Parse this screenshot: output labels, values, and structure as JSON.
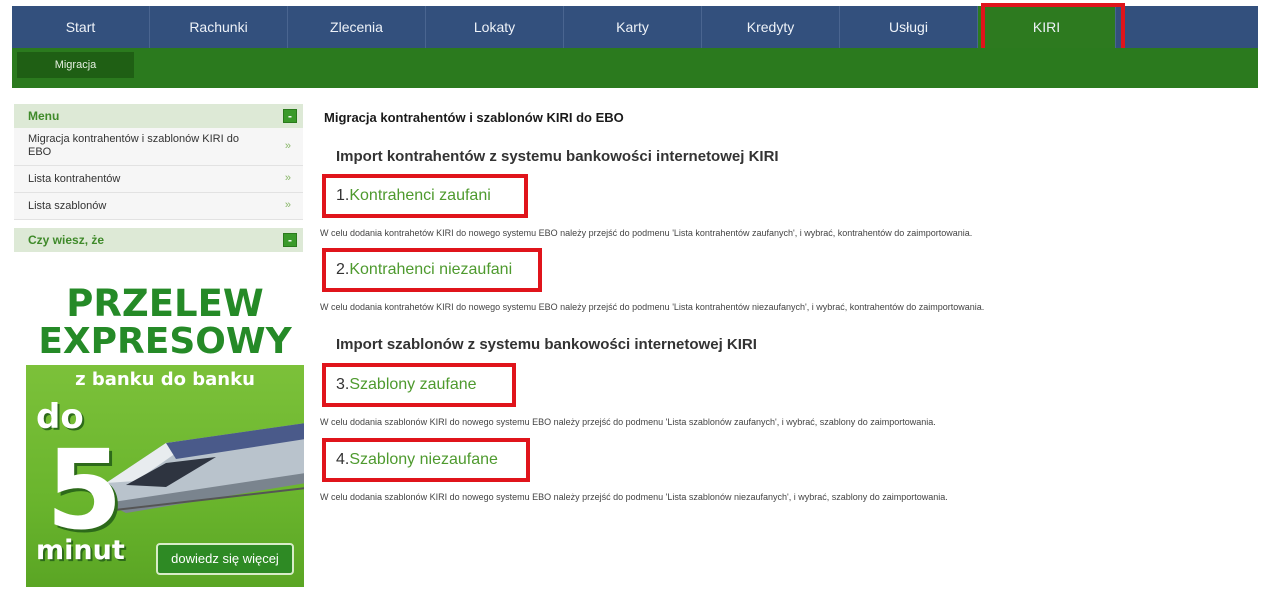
{
  "nav": {
    "items": [
      "Start",
      "Rachunki",
      "Zlecenia",
      "Lokaty",
      "Karty",
      "Kredyty",
      "Usługi",
      "KIRI"
    ]
  },
  "subnav": {
    "item": "Migracja"
  },
  "sidebar": {
    "menu_title": "Menu",
    "items": [
      "Migracja kontrahentów i szablonów KIRI do EBO",
      "Lista kontrahentów",
      "Lista szablonów"
    ],
    "arrow": "»",
    "collapse": "-",
    "didyouknow_title": "Czy wiesz, że"
  },
  "banner": {
    "line1": "PRZELEW",
    "line2": "EXPRESOWY",
    "tagline": "z banku do banku",
    "do": "do",
    "five": "5",
    "minut": "minut",
    "cta": "dowiedz się więcej"
  },
  "main": {
    "title": "Migracja kontrahentów i szablonów KIRI do EBO",
    "section1": "Import kontrahentów z systemu bankowości internetowej KIRI",
    "section2": "Import szablonów z systemu bankowości internetowej KIRI",
    "links": [
      {
        "num": "1.",
        "label": "Kontrahenci zaufani",
        "desc": "W celu dodania kontrahetów KIRI do nowego systemu EBO należy przejść do podmenu 'Lista kontrahentów zaufanych', i wybrać, kontrahentów do zaimportowania."
      },
      {
        "num": "2.",
        "label": "Kontrahenci niezaufani",
        "desc": "W celu dodania kontrahetów KIRI do nowego systemu EBO należy przejść do podmenu 'Lista kontrahentów niezaufanych', i wybrać, kontrahentów do zaimportowania."
      },
      {
        "num": "3.",
        "label": "Szablony zaufane",
        "desc": "W celu dodania szablonów KIRI do nowego systemu EBO należy przejść do podmenu 'Lista szablonów zaufanych', i wybrać, szablony do zaimportowania."
      },
      {
        "num": "4.",
        "label": "Szablony niezaufane",
        "desc": "W celu dodania szablonów KIRI do nowego systemu EBO należy przejść do podmenu 'Lista szablonów niezaufanych', i wybrać, szablony do zaimportowania."
      }
    ]
  },
  "colors": {
    "nav_bg": "#33507d",
    "active_tab": "#2d7a1f",
    "subnav_bg": "#2b7a1e",
    "highlight": "#e0141b",
    "link": "#4e9a2e"
  }
}
